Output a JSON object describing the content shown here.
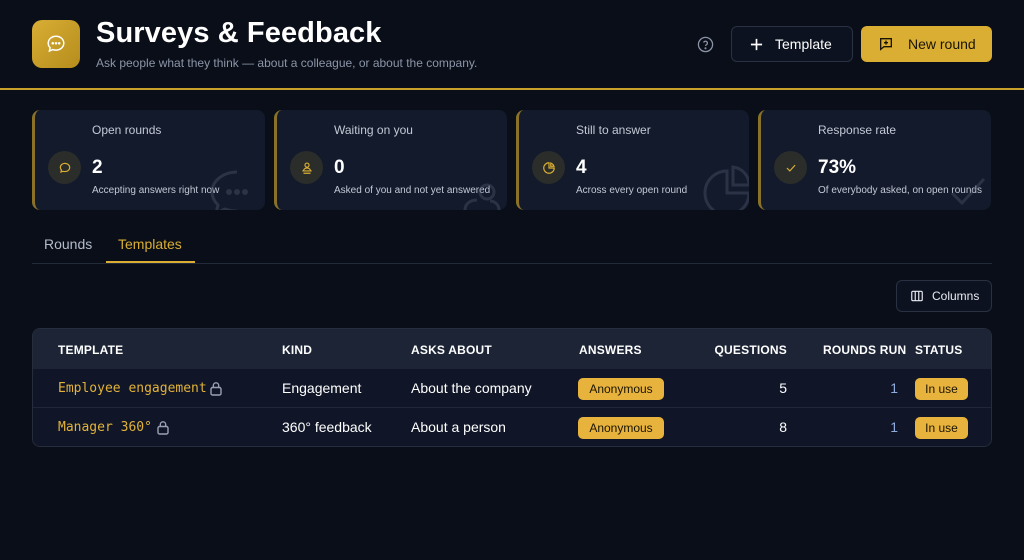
{
  "header": {
    "title": "Surveys & Feedback",
    "subtitle": "Ask people what they think — about a colleague, or about the company.",
    "template_button": "Template",
    "new_round_button": "New round",
    "accent_color": "#d9ae33"
  },
  "stats": [
    {
      "label": "Open rounds",
      "value": "2",
      "desc": "Accepting answers right now",
      "icon": "chat-bubble-icon"
    },
    {
      "label": "Waiting on you",
      "value": "0",
      "desc": "Asked of you and not yet answered",
      "icon": "person-inbox-icon"
    },
    {
      "label": "Still to answer",
      "value": "4",
      "desc": "Across every open round",
      "icon": "pie-chart-icon"
    },
    {
      "label": "Response rate",
      "value": "73%",
      "desc": "Of everybody asked, on open rounds",
      "icon": "check-icon"
    }
  ],
  "tabs": [
    {
      "label": "Rounds",
      "active": false
    },
    {
      "label": "Templates",
      "active": true
    }
  ],
  "columns_button": "Columns",
  "table": {
    "headers": [
      "TEMPLATE",
      "KIND",
      "ASKS ABOUT",
      "ANSWERS",
      "QUESTIONS",
      "ROUNDS RUN",
      "STATUS"
    ],
    "rows": [
      {
        "template": "Employee engagement",
        "kind": "Engagement",
        "asks_about": "About the company",
        "answers": "Anonymous",
        "questions": "5",
        "rounds_run": "1",
        "status": "In use",
        "locked": true
      },
      {
        "template": "Manager 360°",
        "kind": "360° feedback",
        "asks_about": "About a person",
        "answers": "Anonymous",
        "questions": "8",
        "rounds_run": "1",
        "status": "In use",
        "locked": true
      }
    ]
  }
}
